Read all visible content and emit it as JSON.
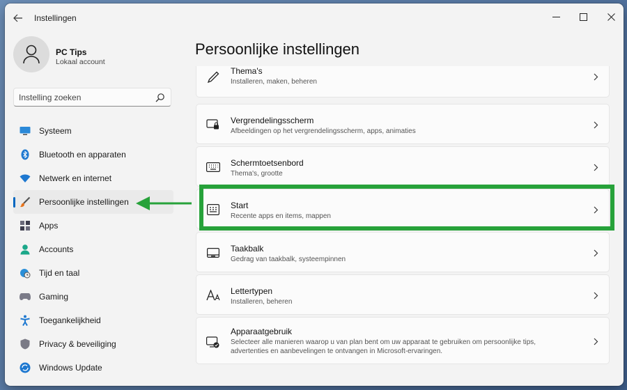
{
  "window": {
    "title": "Instellingen",
    "controls": {
      "minimize": "minimize-icon",
      "maximize": "maximize-icon",
      "close": "close-icon"
    }
  },
  "user": {
    "name": "PC Tips",
    "account_type": "Lokaal account"
  },
  "search": {
    "placeholder": "Instelling zoeken"
  },
  "sidebar": {
    "items": [
      {
        "label": "Systeem",
        "icon": "monitor-icon",
        "active": false
      },
      {
        "label": "Bluetooth en apparaten",
        "icon": "bluetooth-icon",
        "active": false
      },
      {
        "label": "Netwerk en internet",
        "icon": "wifi-icon",
        "active": false
      },
      {
        "label": "Persoonlijke instellingen",
        "icon": "paintbrush-icon",
        "active": true
      },
      {
        "label": "Apps",
        "icon": "apps-icon",
        "active": false
      },
      {
        "label": "Accounts",
        "icon": "person-icon",
        "active": false
      },
      {
        "label": "Tijd en taal",
        "icon": "globe-clock-icon",
        "active": false
      },
      {
        "label": "Gaming",
        "icon": "gamepad-icon",
        "active": false
      },
      {
        "label": "Toegankelijkheid",
        "icon": "accessibility-icon",
        "active": false
      },
      {
        "label": "Privacy & beveiliging",
        "icon": "shield-icon",
        "active": false
      },
      {
        "label": "Windows Update",
        "icon": "update-icon",
        "active": false
      }
    ]
  },
  "main": {
    "title": "Persoonlijke instellingen",
    "cards": [
      {
        "title": "Thema's",
        "subtitle": "Installeren, maken, beheren",
        "icon": "pen-icon"
      },
      {
        "title": "Vergrendelingsscherm",
        "subtitle": "Afbeeldingen op het vergrendelingsscherm, apps, animaties",
        "icon": "lock-screen-icon"
      },
      {
        "title": "Schermtoetsenbord",
        "subtitle": "Thema's, grootte",
        "icon": "keyboard-icon"
      },
      {
        "title": "Start",
        "subtitle": "Recente apps en items, mappen",
        "icon": "start-menu-icon"
      },
      {
        "title": "Taakbalk",
        "subtitle": "Gedrag van taakbalk, systeempinnen",
        "icon": "taskbar-icon"
      },
      {
        "title": "Lettertypen",
        "subtitle": "Installeren, beheren",
        "icon": "font-icon"
      },
      {
        "title": "Apparaatgebruik",
        "subtitle": "Selecteer alle manieren waarop u van plan bent om uw apparaat te gebruiken om persoonlijke tips, advertenties en aanbevelingen te ontvangen in Microsoft-ervaringen.",
        "icon": "device-usage-icon"
      }
    ]
  },
  "annotation": {
    "color": "#27a23a",
    "highlighted_card": "Start"
  },
  "colors": {
    "accent": "#0067c0",
    "highlight": "#27a23a",
    "background": "#f3f3f3"
  }
}
